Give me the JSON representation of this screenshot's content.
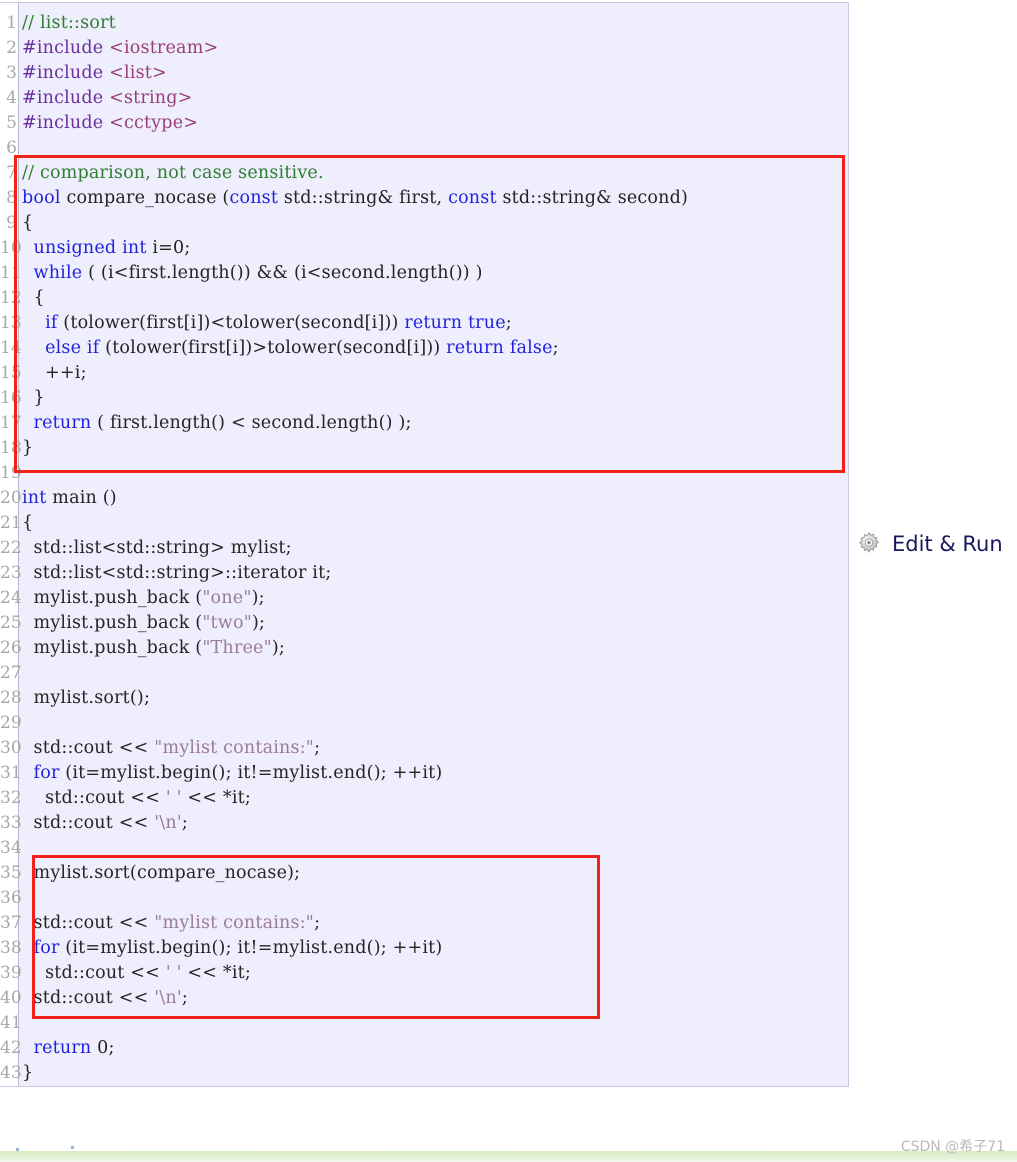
{
  "panel": {
    "background": "#eeeefc",
    "border_color": "#c9c9e0"
  },
  "editor": {
    "first_line_number": 1,
    "total_lines": 43,
    "line_numbers": [
      1,
      2,
      3,
      4,
      5,
      6,
      7,
      8,
      9,
      10,
      11,
      12,
      13,
      14,
      15,
      16,
      17,
      18,
      19,
      20,
      21,
      22,
      23,
      24,
      25,
      26,
      27,
      28,
      29,
      30,
      31,
      32,
      33,
      34,
      35,
      36,
      37,
      38,
      39,
      40,
      41,
      42,
      43
    ],
    "lines": [
      "// list::sort",
      "#include <iostream>",
      "#include <list>",
      "#include <string>",
      "#include <cctype>",
      "",
      "// comparison, not case sensitive.",
      "bool compare_nocase (const std::string& first, const std::string& second)",
      "{",
      "  unsigned int i=0;",
      "  while ( (i<first.length()) && (i<second.length()) )",
      "  {",
      "    if (tolower(first[i])<tolower(second[i])) return true;",
      "    else if (tolower(first[i])>tolower(second[i])) return false;",
      "    ++i;",
      "  }",
      "  return ( first.length() < second.length() );",
      "}",
      "",
      "int main ()",
      "{",
      "  std::list<std::string> mylist;",
      "  std::list<std::string>::iterator it;",
      "  mylist.push_back (\"one\");",
      "  mylist.push_back (\"two\");",
      "  mylist.push_back (\"Three\");",
      "",
      "  mylist.sort();",
      "",
      "  std::cout << \"mylist contains:\";",
      "  for (it=mylist.begin(); it!=mylist.end(); ++it)",
      "    std::cout << ' ' << *it;",
      "  std::cout << '\\n';",
      "",
      "  mylist.sort(compare_nocase);",
      "",
      "  std::cout << \"mylist contains:\";",
      "  for (it=mylist.begin(); it!=mylist.end(); ++it)",
      "    std::cout << ' ' << *it;",
      "  std::cout << '\\n';",
      "",
      "  return 0;",
      "}"
    ],
    "colors": {
      "comment": "#2e7d32",
      "keyword": "#2222dd",
      "preprocessor": "#6a2fa0",
      "include_target": "#9a3d7a",
      "string": "#9b7b9b",
      "plain": "#242424",
      "line_number": "#a8a8a8"
    }
  },
  "highlights": [
    {
      "name": "compare-nocase-function",
      "lines": "7-19",
      "color": "#f0231a"
    },
    {
      "name": "sort-with-comparator",
      "lines": "35-40",
      "color": "#f0231a"
    }
  ],
  "edit_run": {
    "label": "Edit & Run",
    "icon": "gear-icon",
    "text_color": "#18185c"
  },
  "watermark": {
    "text": "CSDN @希子71"
  }
}
